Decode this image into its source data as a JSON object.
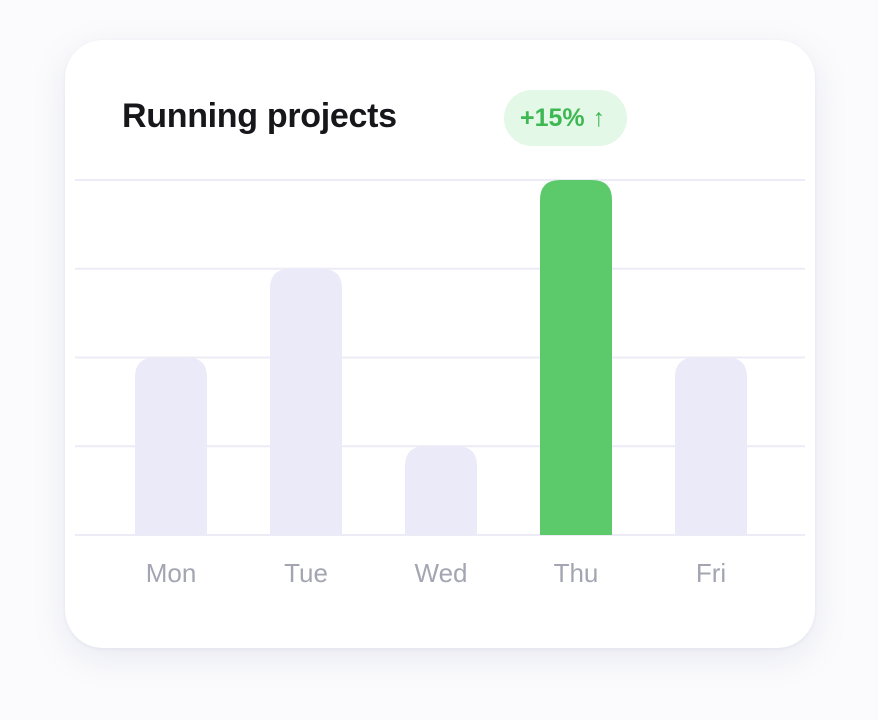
{
  "card": {
    "title": "Running projects",
    "badge": {
      "text": "+15%",
      "icon": "arrow-up-icon",
      "glyph": "↑",
      "color": "#3fb853",
      "background": "#e3f8e6"
    }
  },
  "chart_data": {
    "type": "bar",
    "title": "Running projects",
    "categories": [
      "Mon",
      "Tue",
      "Wed",
      "Thu",
      "Fri"
    ],
    "values": [
      2,
      3,
      1,
      4,
      2
    ],
    "highlight_index": 3,
    "ylim": [
      0,
      4
    ],
    "grid": true,
    "bar_color": "#ebeaf8",
    "highlight_color": "#5cc96a",
    "gridline_color": "#ecebf6"
  }
}
